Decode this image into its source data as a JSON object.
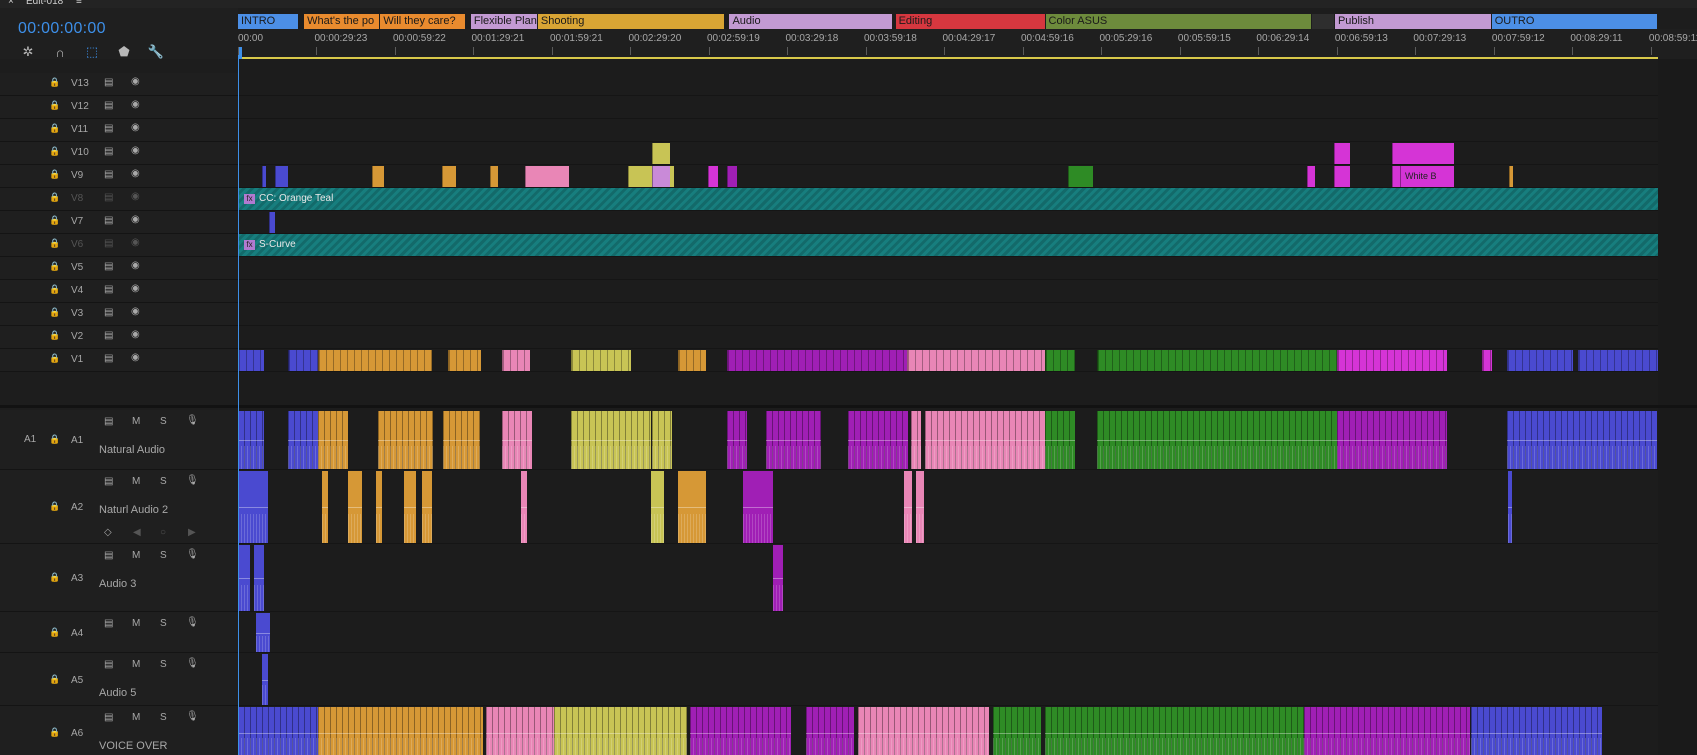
{
  "window": {
    "title": "Edit-018",
    "menu_icon": "hamburger-icon",
    "close_icon": "close-icon"
  },
  "timecode": "00:00:00:00",
  "toolbar": {
    "tools": [
      {
        "name": "snap-icon",
        "glyph": "✲",
        "active": false
      },
      {
        "name": "linked-selection-icon",
        "glyph": "∩",
        "active": false
      },
      {
        "name": "selection-tool-icon",
        "glyph": "⬚",
        "active": true
      },
      {
        "name": "add-marker-icon",
        "glyph": "⬟",
        "active": false
      },
      {
        "name": "wrench-icon",
        "glyph": "🔧",
        "active": false
      }
    ]
  },
  "markers": [
    {
      "label": "INTRO",
      "color": "#4c8fe6",
      "start": 0,
      "end": 0.0432
    },
    {
      "label": "What's the po",
      "color": "#e98b2e",
      "start": 0.0466,
      "end": 0.1003
    },
    {
      "label": "Will they care?",
      "color": "#e98b2e",
      "start": 0.1003,
      "end": 0.1606
    },
    {
      "label": "Flexible Plan",
      "color": "#c39ad3",
      "start": 0.164,
      "end": 0.2112
    },
    {
      "label": "Shooting",
      "color": "#d9a534",
      "start": 0.2112,
      "end": 0.3431
    },
    {
      "label": "Audio",
      "color": "#c39ad3",
      "start": 0.3461,
      "end": 0.4614
    },
    {
      "label": "Editing",
      "color": "#d6373f",
      "start": 0.4631,
      "end": 0.5687
    },
    {
      "label": "Color ASUS",
      "color": "#6d8b3c",
      "start": 0.5687,
      "end": 0.7561
    },
    {
      "label": "",
      "color": "#2e2e2e",
      "start": 0.7561,
      "end": 0.7725
    },
    {
      "label": "Publish",
      "color": "#c39ad3",
      "start": 0.7725,
      "end": 0.8829
    },
    {
      "label": "OUTRO",
      "color": "#4c8fe6",
      "start": 0.8829,
      "end": 1.0
    }
  ],
  "ruler": {
    "labels": [
      "00:00",
      "00:00:29:23",
      "00:00:59:22",
      "00:01:29:21",
      "00:01:59:21",
      "00:02:29:20",
      "00:02:59:19",
      "00:03:29:18",
      "00:03:59:18",
      "00:04:29:17",
      "00:04:59:16",
      "00:05:29:16",
      "00:05:59:15",
      "00:06:29:14",
      "00:06:59:13",
      "00:07:29:13",
      "00:07:59:12",
      "00:08:29:11",
      "00:08:59:11"
    ]
  },
  "video_tracks": [
    {
      "id": "V13",
      "locked": false
    },
    {
      "id": "V12",
      "locked": false
    },
    {
      "id": "V11",
      "locked": false
    },
    {
      "id": "V10",
      "locked": false
    },
    {
      "id": "V9",
      "locked": false
    },
    {
      "id": "V8",
      "locked": true
    },
    {
      "id": "V7",
      "locked": false
    },
    {
      "id": "V6",
      "locked": true
    },
    {
      "id": "V5",
      "locked": false
    },
    {
      "id": "V4",
      "locked": false
    },
    {
      "id": "V3",
      "locked": false
    },
    {
      "id": "V2",
      "locked": false
    },
    {
      "id": "V1",
      "locked": false
    }
  ],
  "audio_tracks": [
    {
      "src": "A1",
      "id": "A1",
      "name": "Natural Audio"
    },
    {
      "src": "",
      "id": "A2",
      "name": "Naturl Audio 2"
    },
    {
      "src": "",
      "id": "A3",
      "name": "Audio 3"
    },
    {
      "src": "",
      "id": "A4",
      "name": ""
    },
    {
      "src": "",
      "id": "A5",
      "name": "Audio 5"
    },
    {
      "src": "",
      "id": "A6",
      "name": "VOICE OVER"
    }
  ],
  "audio_buttons": {
    "mute": "M",
    "solo": "S"
  },
  "adjustment_layers": [
    {
      "label": "CC: Orange Teal",
      "track": "V8"
    },
    {
      "label": "S-Curve",
      "track": "V6"
    }
  ],
  "clip_labels": {
    "white_b": "White B",
    "fx": "fx"
  },
  "colors": {
    "accent": "#3d8fe8",
    "adjustment": "#177e7e",
    "workarea": "#d8c94a"
  }
}
